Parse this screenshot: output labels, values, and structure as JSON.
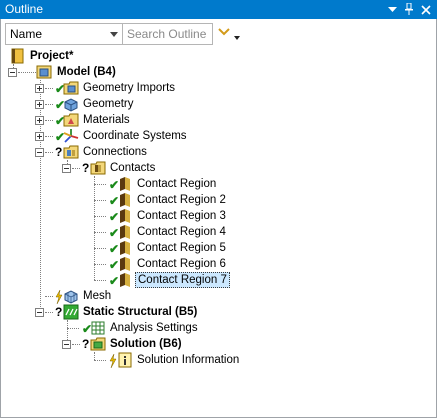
{
  "window": {
    "title": "Outline",
    "buttons": {
      "dropdown": "▾",
      "pin": "📌",
      "close": "×"
    }
  },
  "toolbar": {
    "sort_field": "Name",
    "search_placeholder": "Search Outline",
    "search_value": ""
  },
  "tree": {
    "project": "Project*",
    "model": "Model (B4)",
    "geometry_imports": "Geometry Imports",
    "geometry": "Geometry",
    "materials": "Materials",
    "coordinate_systems": "Coordinate Systems",
    "connections": "Connections",
    "contacts": "Contacts",
    "contact_regions": [
      "Contact Region",
      "Contact Region 2",
      "Contact Region 3",
      "Contact Region 4",
      "Contact Region 5",
      "Contact Region 6",
      "Contact Region 7"
    ],
    "mesh": "Mesh",
    "static_structural": "Static Structural (B5)",
    "analysis_settings": "Analysis Settings",
    "solution": "Solution (B6)",
    "solution_information": "Solution Information"
  },
  "colors": {
    "title_bar": "#007acc",
    "selection": "#cce8ff",
    "check": "#1a8a1a",
    "bolt": "#e6b800"
  }
}
